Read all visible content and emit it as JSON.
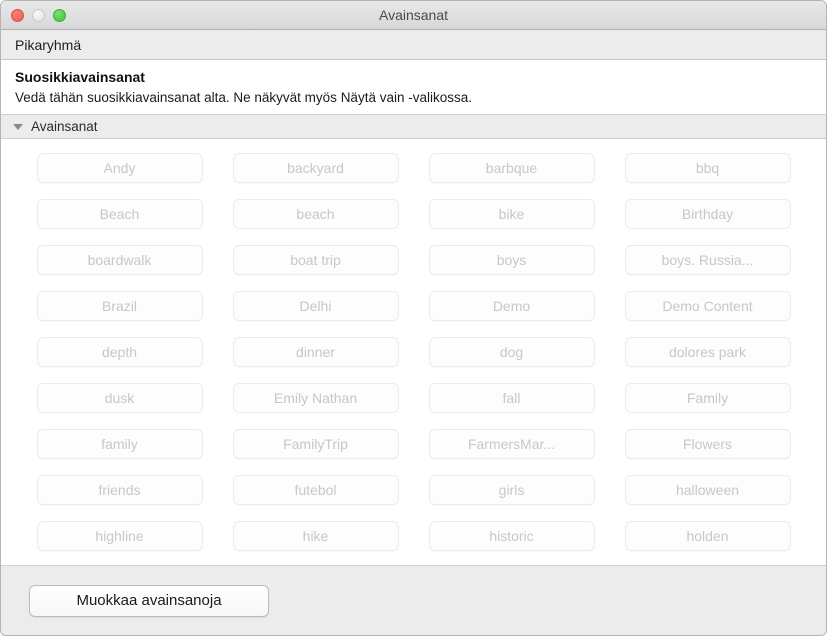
{
  "window": {
    "title": "Avainsanat",
    "controls": {
      "close_label": "close-button",
      "minimize_label": "minimize-button",
      "zoom_label": "zoom-button"
    }
  },
  "toolbar": {
    "quick_group_label": "Pikaryhmä"
  },
  "favorites": {
    "title": "Suosikkiavainsanat",
    "description": "Vedä tähän suosikkiavainsanat alta. Ne näkyvät myös Näytä vain -valikossa."
  },
  "section": {
    "title": "Avainsanat",
    "expanded": true,
    "disclosure_icon": "triangle-down-icon"
  },
  "keywords": [
    "Andy",
    "backyard",
    "barbque",
    "bbq",
    "Beach",
    "beach",
    "bike",
    "Birthday",
    "boardwalk",
    "boat trip",
    "boys",
    "boys. Russia...",
    "Brazil",
    "Delhi",
    "Demo",
    "Demo Content",
    "depth",
    "dinner",
    "dog",
    "dolores park",
    "dusk",
    "Emily Nathan",
    "fall",
    "Family",
    "family",
    "FamilyTrip",
    "FarmersMar...",
    "Flowers",
    "friends",
    "futebol",
    "girls",
    "halloween",
    "highline",
    "hike",
    "historic",
    "holden"
  ],
  "footer": {
    "edit_keywords_label": "Muokkaa avainsanoja"
  },
  "colors": {
    "titlebar_top": "#e8e8e8",
    "titlebar_bottom": "#d8d8d8",
    "toolbar_bg": "#ececec",
    "keyword_text": "#c7c7c7",
    "keyword_border": "#ececec",
    "close_red": "#ec6a5e",
    "minimize_gray": "#e6e6e6",
    "zoom_green": "#4fc84a"
  }
}
